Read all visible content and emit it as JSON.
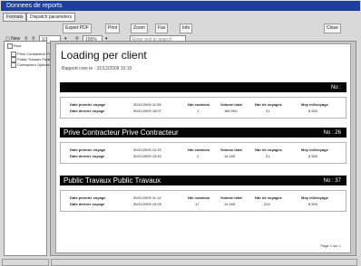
{
  "window": {
    "title": "Donnees de reports"
  },
  "tabs": [
    {
      "label": "Formats"
    },
    {
      "label": "Dispatch parameters"
    }
  ],
  "toolbar": {
    "items": [
      {
        "label": "Export PDF"
      },
      {
        "label": "Print"
      },
      {
        "label": "Zoom"
      },
      {
        "label": "Fax"
      },
      {
        "label": "Info"
      }
    ],
    "close_label": "Close"
  },
  "toolbar2": {
    "new_label": "New",
    "page_field": "1/1",
    "zoom_field": "100%",
    "search_placeholder": "Enter text to search"
  },
  "sidebar": {
    "items": [
      {
        "label": "Root"
      },
      {
        "label": "Prive Contracteur Prive"
      },
      {
        "label": "Public Travaux Public"
      },
      {
        "label": "Contracteur Options"
      }
    ]
  },
  "report": {
    "title": "Loading per client",
    "subtitle": "Rapport cree le : 31/12/2009 10:10",
    "sections": [
      {
        "title": "",
        "count": "No :",
        "row1_label": "Date premier voyage",
        "row1_date": "30/11/2009 11:05",
        "row2_label": "Date dernier voyage",
        "row2_date": "30/11/2009 15:07",
        "headers": [
          "Nbr camions",
          "Volume total",
          "Nbr de voyages",
          "Moy m3/voyage"
        ],
        "values": [
          "1",
          "180 000",
          "21",
          "8 500"
        ]
      },
      {
        "title": "Prive Contracteur Prive Contracteur",
        "count": "No : 26",
        "row1_label": "Date premier voyage",
        "row1_date": "30/11/2009 12:20",
        "row2_label": "Date dernier voyage",
        "row2_date": "30/11/2009 13:40",
        "headers": [
          "Nbr camions",
          "Volume total",
          "Nbr de voyages",
          "Moy m3/voyage"
        ],
        "values": [
          "1",
          "14 400",
          "21",
          "8 500"
        ]
      },
      {
        "title": "Public Travaux Public Travaux",
        "count": "No : 37",
        "row1_label": "Date premier voyage",
        "row1_date": "30/11/2009 11:12",
        "row2_label": "Date dernier voyage",
        "row2_date": "30/11/2009 19:05",
        "headers": [
          "Nbr camions",
          "Volume total",
          "Nbr de voyages",
          "Moy m3/voyage"
        ],
        "values": [
          "17",
          "14 400",
          "224",
          "8 500"
        ]
      }
    ],
    "page_label": "Page 1 sur 1"
  },
  "status": {
    "text": ""
  }
}
